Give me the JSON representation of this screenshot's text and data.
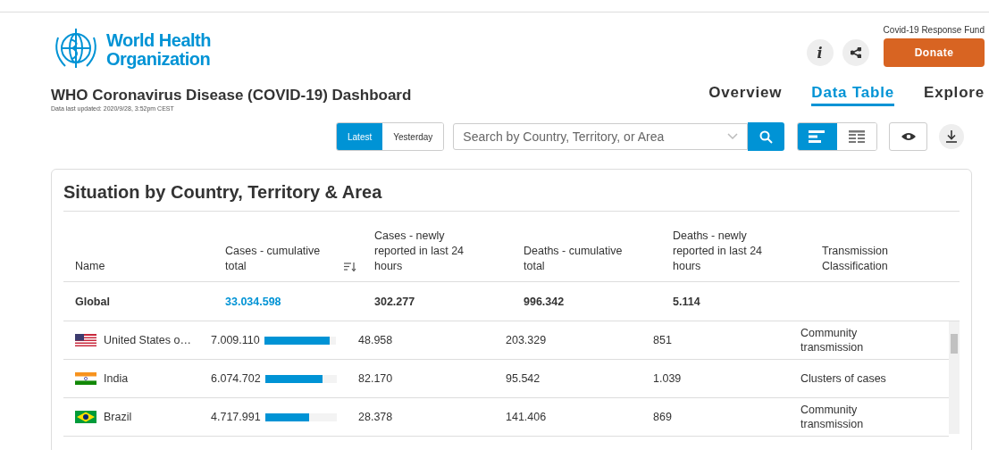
{
  "logo": {
    "line1": "World Health",
    "line2": "Organization"
  },
  "title": "WHO Coronavirus Disease (COVID-19) Dashboard",
  "updated": "Data last updated: 2020/9/28, 3:52pm CEST",
  "fund_label": "Covid-19 Response Fund",
  "donate": "Donate",
  "info_glyph": "i",
  "nav": [
    {
      "label": "Overview",
      "selected": false
    },
    {
      "label": "Data Table",
      "selected": true
    },
    {
      "label": "Explore",
      "selected": false
    }
  ],
  "period": [
    {
      "label": "Latest",
      "selected": true
    },
    {
      "label": "Yesterday",
      "selected": false
    }
  ],
  "search": {
    "placeholder": "Search by Country, Territory, or Area"
  },
  "view_toggle": [
    {
      "kind": "bars",
      "selected": true
    },
    {
      "kind": "table",
      "selected": false
    }
  ],
  "card_title": "Situation by Country, Territory & Area",
  "columns": [
    "Name",
    "Cases - cumulative total",
    "Cases - newly reported in last 24 hours",
    "Deaths - cumulative total",
    "Deaths - newly reported in last 24 hours",
    "Transmission Classification"
  ],
  "global": {
    "name": "Global",
    "cases": "33.034.598",
    "new_cases": "302.277",
    "deaths": "996.342",
    "new_deaths": "5.114"
  },
  "rows": [
    {
      "kind": "us",
      "name": "United States o…",
      "cases": "7.009.110",
      "level": 0.92,
      "new_cases": "48.958",
      "deaths": "203.329",
      "new_deaths": "851",
      "transmission": "Community transmission"
    },
    {
      "kind": "in",
      "name": "India",
      "cases": "6.074.702",
      "level": 0.8,
      "new_cases": "82.170",
      "deaths": "95.542",
      "new_deaths": "1.039",
      "transmission": "Clusters of cases"
    },
    {
      "kind": "br",
      "name": "Brazil",
      "cases": "4.717.991",
      "level": 0.62,
      "new_cases": "28.378",
      "deaths": "141.406",
      "new_deaths": "869",
      "transmission": "Community transmission"
    }
  ]
}
